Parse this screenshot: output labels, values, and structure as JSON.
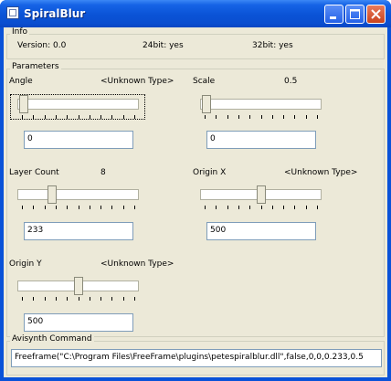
{
  "window": {
    "title": "SpiralBlur"
  },
  "info": {
    "group_title": "Info",
    "version": "Version: 0.0",
    "bit24": "24bit: yes",
    "bit32": "32bit: yes"
  },
  "parameters": {
    "group_title": "Parameters",
    "items": [
      {
        "name": "Angle",
        "type_value": "<Unknown Type>",
        "input_value": "0"
      },
      {
        "name": "Scale",
        "type_value": "0.5",
        "input_value": "0"
      },
      {
        "name": "Layer Count",
        "type_value": "8",
        "input_value": "233"
      },
      {
        "name": "Origin X",
        "type_value": "<Unknown Type>",
        "input_value": "500"
      },
      {
        "name": "Origin Y",
        "type_value": "<Unknown Type>",
        "input_value": "500"
      }
    ]
  },
  "avisynth": {
    "group_title": "Avisynth Command",
    "command": "Freeframe(\"C:\\Program Files\\FreeFrame\\plugins\\petespiralblur.dll\",false,0,0,0.233,0.5"
  },
  "slider_levels": [
    0.02,
    0.02,
    0.27,
    0.5,
    0.5
  ]
}
